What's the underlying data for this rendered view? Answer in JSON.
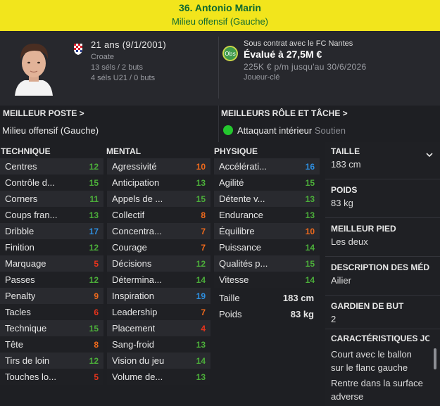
{
  "header": {
    "name": "36. Antonio Marin",
    "role": "Milieu offensif (Gauche)"
  },
  "profile": {
    "age": "21 ans (9/1/2001)",
    "nationality": "Croate",
    "caps": "13 séls / 2 buts",
    "u21": "4 séls U21 / 0 buts",
    "contract": "Sous contrat avec le FC Nantes",
    "value": "Évalué à 27,5M €",
    "wage": "225K € p/m jusqu'au 30/6/2026",
    "status": "Joueur-clé",
    "club_badge": "Obs"
  },
  "positions": {
    "best_position_label": "MEILLEUR POSTE >",
    "best_position": "Milieu offensif (Gauche)",
    "best_role_label": "MEILLEURS RÔLE ET TÂCHE >",
    "best_role": "Attaquant intérieur",
    "best_duty": "Soutien"
  },
  "columns": {
    "technique": "TECHNIQUE",
    "mental": "MENTAL",
    "physique": "PHYSIQUE"
  },
  "technique": [
    {
      "name": "Centres",
      "value": "12"
    },
    {
      "name": "Contrôle d...",
      "value": "15"
    },
    {
      "name": "Corners",
      "value": "11"
    },
    {
      "name": "Coups fran...",
      "value": "13"
    },
    {
      "name": "Dribble",
      "value": "17"
    },
    {
      "name": "Finition",
      "value": "12"
    },
    {
      "name": "Marquage",
      "value": "5"
    },
    {
      "name": "Passes",
      "value": "12"
    },
    {
      "name": "Penalty",
      "value": "9"
    },
    {
      "name": "Tacles",
      "value": "6"
    },
    {
      "name": "Technique",
      "value": "15"
    },
    {
      "name": "Tête",
      "value": "8"
    },
    {
      "name": "Tirs de loin",
      "value": "12"
    },
    {
      "name": "Touches lo...",
      "value": "5"
    }
  ],
  "mental": [
    {
      "name": "Agressivité",
      "value": "10"
    },
    {
      "name": "Anticipation",
      "value": "13"
    },
    {
      "name": "Appels de ...",
      "value": "15"
    },
    {
      "name": "Collectif",
      "value": "8"
    },
    {
      "name": "Concentra...",
      "value": "7"
    },
    {
      "name": "Courage",
      "value": "7"
    },
    {
      "name": "Décisions",
      "value": "12"
    },
    {
      "name": "Détermina...",
      "value": "14"
    },
    {
      "name": "Inspiration",
      "value": "19"
    },
    {
      "name": "Leadership",
      "value": "7"
    },
    {
      "name": "Placement",
      "value": "4"
    },
    {
      "name": "Sang-froid",
      "value": "13"
    },
    {
      "name": "Vision du jeu",
      "value": "14"
    },
    {
      "name": "Volume de...",
      "value": "13"
    }
  ],
  "physique": [
    {
      "name": "Accélérati...",
      "value": "16"
    },
    {
      "name": "Agilité",
      "value": "15"
    },
    {
      "name": "Détente v...",
      "value": "13"
    },
    {
      "name": "Endurance",
      "value": "13"
    },
    {
      "name": "Équilibre",
      "value": "10"
    },
    {
      "name": "Puissance",
      "value": "14"
    },
    {
      "name": "Qualités p...",
      "value": "15"
    },
    {
      "name": "Vitesse",
      "value": "14"
    }
  ],
  "body": {
    "height_label": "Taille",
    "height": "183 cm",
    "weight_label": "Poids",
    "weight": "83 kg"
  },
  "side": {
    "height_label": "TAILLE",
    "height": "183 cm",
    "weight_label": "POIDS",
    "weight": "83 kg",
    "foot_label": "MEILLEUR PIED",
    "foot": "Les deux",
    "media_label": "DESCRIPTION DES MÉDI...",
    "media": "Ailier",
    "gk_label": "GARDIEN DE BUT",
    "gk": "2",
    "traits_label": "CARACTÉRISTIQUES JO...",
    "trait1_a": "Court avec le ballon",
    "trait1_b": "sur le flanc gauche",
    "trait2_a": "Rentre dans la surface",
    "trait2_b": "adverse"
  },
  "colors": {
    "low": "#e8341c",
    "mid": "#f06a1c",
    "good": "#4caf3a",
    "great": "#2e8fe0",
    "header_bg": "#f2e51c",
    "header_text": "#0f6a30"
  }
}
